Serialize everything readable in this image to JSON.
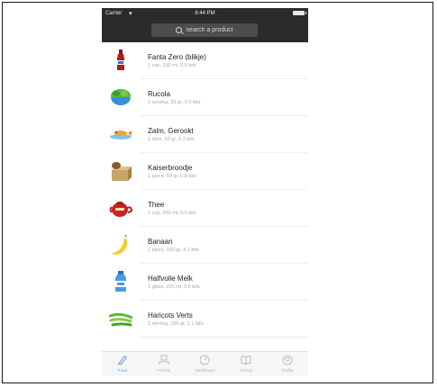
{
  "status": {
    "carrier": "Carrier",
    "time": "6:44 PM"
  },
  "search": {
    "placeholder": "search a product"
  },
  "items": [
    {
      "name": "Fanta Zero (blikje)",
      "detail": "1 can, 330 ml, 0.5 bits",
      "icon": "soda-bottle-icon"
    },
    {
      "name": "Rucola",
      "detail": "1 serving, 50 gr, 0.3 bits",
      "icon": "salad-bowl-icon"
    },
    {
      "name": "Zalm, Gerookt",
      "detail": "1 slice, 50 gr, 3.3 bits",
      "icon": "fish-icon"
    },
    {
      "name": "Kaiserbroodje",
      "detail": "1 piece, 50 gr, 5.8 bits",
      "icon": "bread-roll-icon"
    },
    {
      "name": "Thee",
      "detail": "1 cup, 250 ml, 0.0 bits",
      "icon": "teapot-icon"
    },
    {
      "name": "Banaan",
      "detail": "1 piece, 150 gr, 4.2 bits",
      "icon": "banana-icon"
    },
    {
      "name": "Halfvolle Melk",
      "detail": "1 glass, 200 ml, 3.5 bits",
      "icon": "milk-bottle-icon"
    },
    {
      "name": "Haricots Verts",
      "detail": "1 serving, 100 gr, 1.1 bits",
      "icon": "green-beans-icon"
    }
  ],
  "tabs": [
    {
      "label": "Food",
      "icon": "food-icon",
      "active": true
    },
    {
      "label": "Friends",
      "icon": "friends-icon",
      "active": false
    },
    {
      "label": "Dashboard",
      "icon": "dashboard-icon",
      "active": false
    },
    {
      "label": "History",
      "icon": "history-icon",
      "active": false
    },
    {
      "label": "Profile",
      "icon": "profile-icon",
      "active": false
    }
  ],
  "colors": {
    "header": "#2b2b2b",
    "accent": "#5b9bd5",
    "detail_text": "#a8a8a8"
  }
}
